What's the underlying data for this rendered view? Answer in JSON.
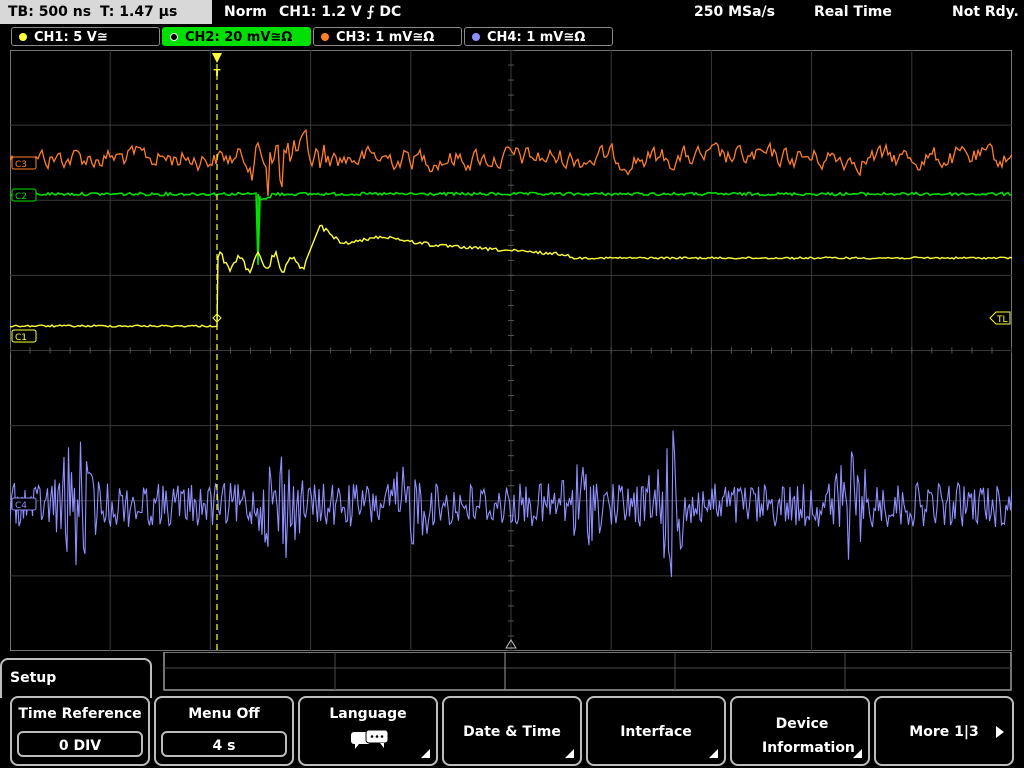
{
  "status": {
    "timebase": "TB: 500 ns",
    "trigger_time": "T: 1.47 µs",
    "mode": "Norm",
    "trigger": "CH1: 1.2 V ⨍ DC",
    "sample_rate": "250 MSa/s",
    "acq_mode": "Real Time",
    "trig_status": "Not Rdy."
  },
  "channels": [
    {
      "label": "CH1: 5 V≅",
      "color": "#ffff33"
    },
    {
      "label": "CH2: 20 mV≅Ω",
      "color": "#00e000"
    },
    {
      "label": "CH3: 1 mV≅Ω",
      "color": "#ff7f27"
    },
    {
      "label": "CH4: 1 mV≅Ω",
      "color": "#8f8fff"
    }
  ],
  "markers": {
    "ch1": "C1",
    "ch2": "C2",
    "ch3": "C3",
    "ch4": "C4",
    "trigger_level": "TL",
    "trigger_pos": "T"
  },
  "menu": {
    "title": "Setup",
    "softkeys": [
      {
        "label": "Time Reference",
        "value": "0 DIV"
      },
      {
        "label": "Menu Off",
        "value": "4 s"
      },
      {
        "label": "Language",
        "icon": "speech-bubbles-icon"
      },
      {
        "label": "Date & Time"
      },
      {
        "label": "Interface"
      },
      {
        "label": "Device Information"
      },
      {
        "label": "More 1|3"
      }
    ]
  },
  "colors": {
    "ch1": "#ffff33",
    "ch2": "#00e000",
    "ch3": "#ff7f27",
    "ch4": "#8f8fff",
    "grid": "#4a4a4a",
    "trigger": "#ffff33"
  }
}
